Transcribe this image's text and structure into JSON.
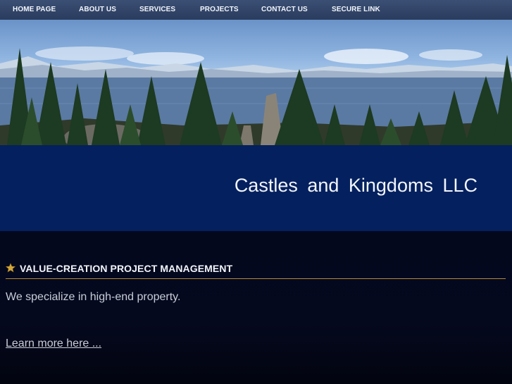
{
  "nav": {
    "items": [
      {
        "label": "HOME PAGE"
      },
      {
        "label": "ABOUT US"
      },
      {
        "label": "SERVICES"
      },
      {
        "label": "PROJECTS"
      },
      {
        "label": "CONTACT US"
      },
      {
        "label": "SECURE LINK"
      }
    ]
  },
  "header": {
    "company_name": "Castles and Kingdoms LLC"
  },
  "section": {
    "heading": "Value-creation project management",
    "body": "We specialize in high-end property.",
    "link": "Learn more here ..."
  },
  "colors": {
    "nav_bg": "#2f4266",
    "title_band": "#04205e",
    "content_bg": "#03081f",
    "accent_line": "#b08a3a",
    "star": "#d4a73a"
  },
  "icons": {
    "heading_icon": "star-icon"
  }
}
